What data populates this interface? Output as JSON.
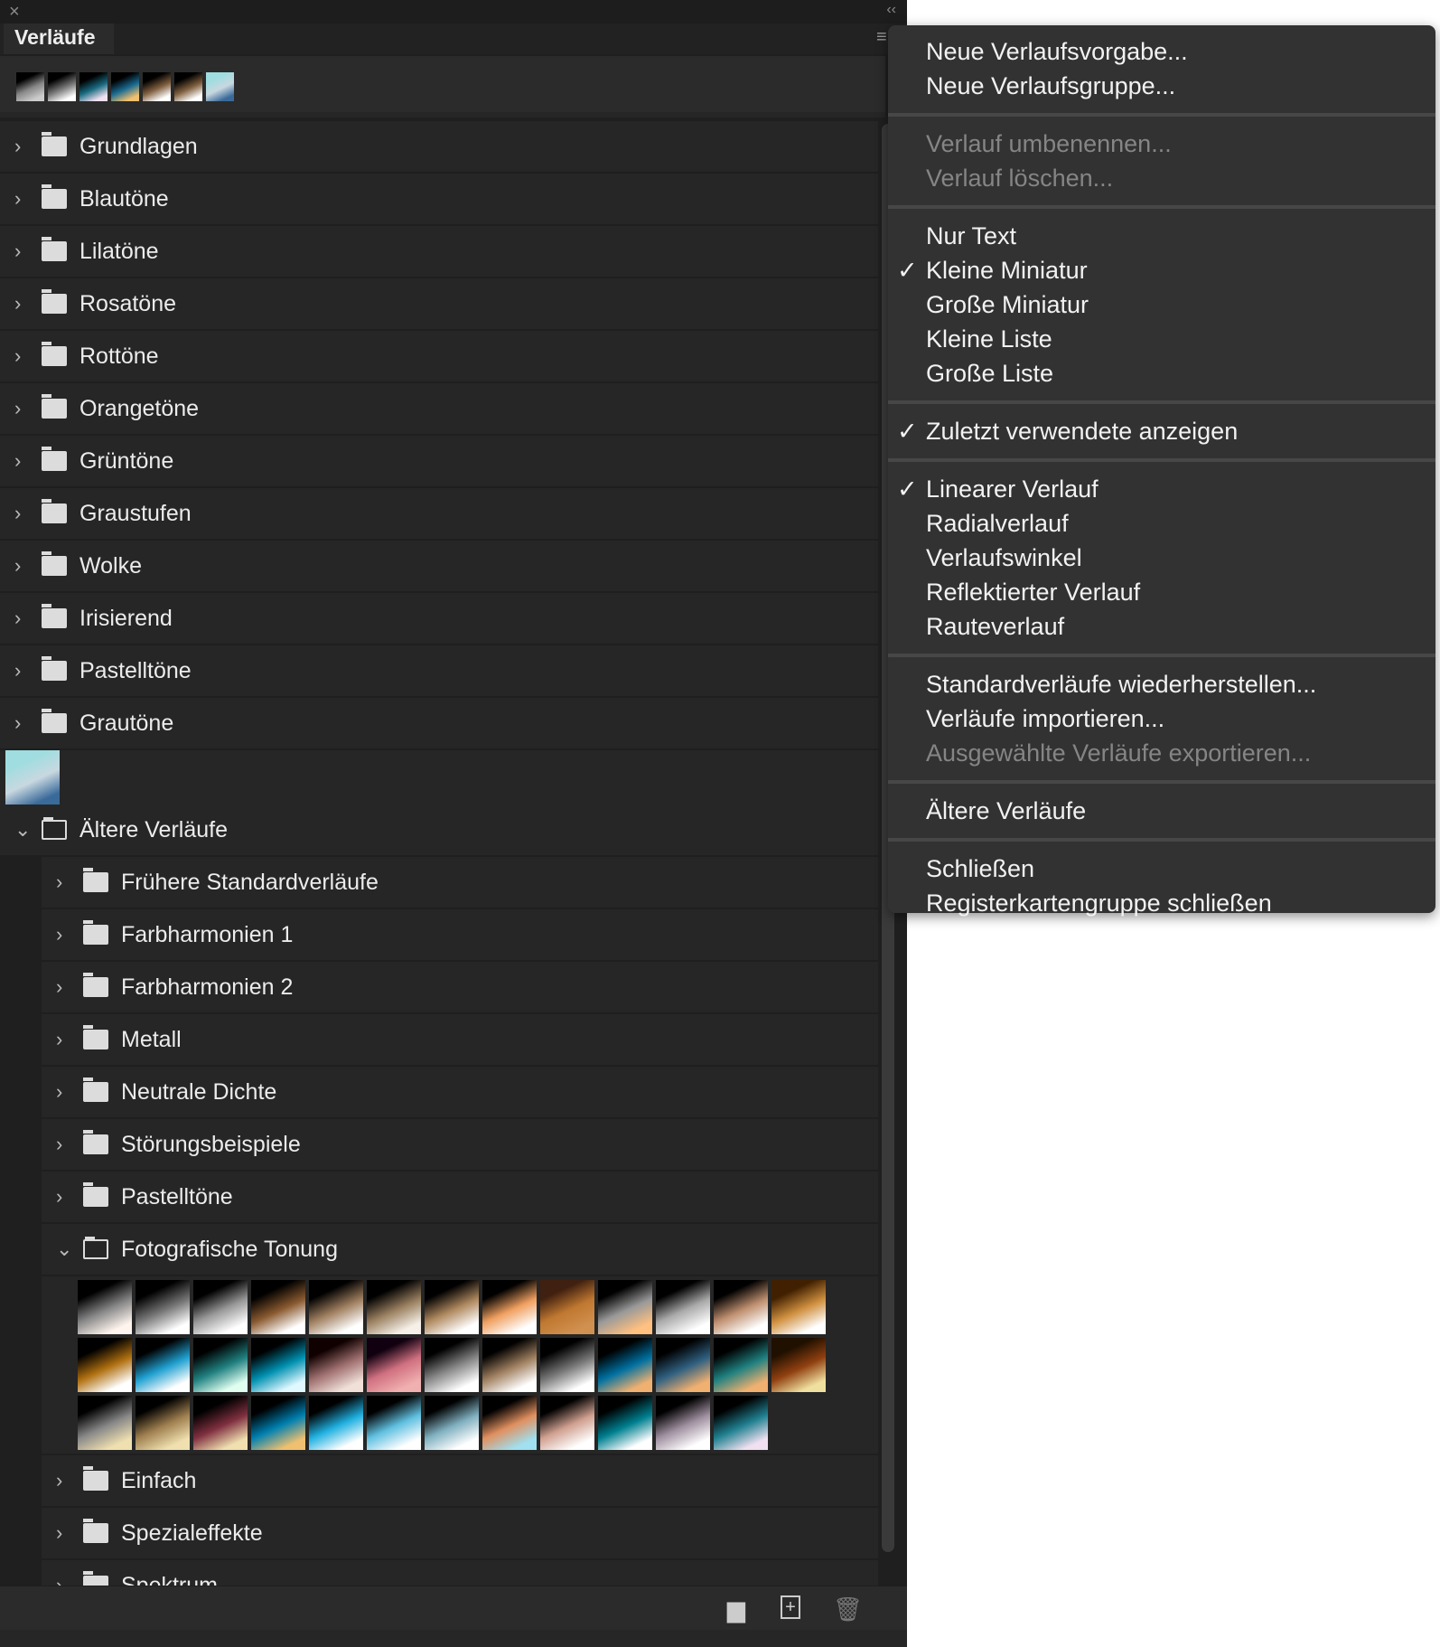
{
  "panel": {
    "title": "Verläufe",
    "close": "×",
    "collapse": "‹‹",
    "menu": "≡"
  },
  "recents": [
    [
      "#000",
      "#888",
      "#ccc"
    ],
    [
      "#000",
      "#777",
      "#fff"
    ],
    [
      "#000",
      "#1a6a80",
      "#f0e0f0"
    ],
    [
      "#000",
      "#1a6a90",
      "#f0c070"
    ],
    [
      "#000",
      "#806040",
      "#fff"
    ],
    [
      "#000",
      "#806040",
      "#fff"
    ],
    [
      "#9fdde0",
      "#c8d8e0",
      "#3a6a9a"
    ]
  ],
  "folders": [
    "Grundlagen",
    "Blautöne",
    "Lilatöne",
    "Rosatöne",
    "Rottöne",
    "Orangetöne",
    "Grüntöne",
    "Graustufen",
    "Wolke",
    "Irisierend",
    "Pastelltöne",
    "Grautöne"
  ],
  "single_swatch": [
    "#9fdde0",
    "#c8d8e0",
    "#3a6a9a"
  ],
  "legacy": {
    "label": "Ältere Verläufe",
    "children": [
      "Frühere Standardverläufe",
      "Farbharmonien 1",
      "Farbharmonien 2",
      "Metall",
      "Neutrale Dichte",
      "Störungsbeispiele",
      "Pastelltöne"
    ],
    "open_child": "Fotografische Tonung",
    "after": [
      "Einfach",
      "Spezialeffekte",
      "Spektrum"
    ]
  },
  "toning": [
    [
      "#000",
      "#888",
      "#fff5ee"
    ],
    [
      "#000",
      "#777",
      "#fff"
    ],
    [
      "#000",
      "#999",
      "#fff"
    ],
    [
      "#000",
      "#8a5a30",
      "#fff"
    ],
    [
      "#000",
      "#a08060",
      "#fff"
    ],
    [
      "#000",
      "#9a8060",
      "#f5f0e8"
    ],
    [
      "#000",
      "#b08a60",
      "#fff"
    ],
    [
      "#000",
      "#f0a060",
      "#fff"
    ],
    [
      "#402010",
      "#c07830",
      "#d09050"
    ],
    [
      "#000",
      "#999",
      "#ffc080"
    ],
    [
      "#000",
      "#aaa",
      "#fff"
    ],
    [
      "#000",
      "#c09070",
      "#fff"
    ],
    [
      "#402000",
      "#d09040",
      "#fff"
    ],
    [
      "#000",
      "#b07010",
      "#fff"
    ],
    [
      "#000",
      "#20a0d0",
      "#fff"
    ],
    [
      "#000",
      "#208080",
      "#e0fff0"
    ],
    [
      "#000",
      "#0090b0",
      "#e0f8ff"
    ],
    [
      "#100000",
      "#a07070",
      "#f0e0d8"
    ],
    [
      "#100010",
      "#d07080",
      "#f0b0b0"
    ],
    [
      "#000",
      "#888",
      "#fff"
    ],
    [
      "#000",
      "#a08060",
      "#fff"
    ],
    [
      "#000",
      "#777",
      "#fff"
    ],
    [
      "#000",
      "#0070a0",
      "#f0b070"
    ],
    [
      "#000",
      "#306080",
      "#f0b070"
    ],
    [
      "#000",
      "#208080",
      "#f0b070"
    ],
    [
      "#201000",
      "#904010",
      "#f0e0a0"
    ],
    [
      "#000",
      "#888",
      "#f0e0b0"
    ],
    [
      "#000",
      "#a08050",
      "#f0e0b0"
    ],
    [
      "#000",
      "#803040",
      "#f0e0b0"
    ],
    [
      "#000",
      "#0080b0",
      "#f0c070"
    ],
    [
      "#000",
      "#20b0e0",
      "#fff"
    ],
    [
      "#000",
      "#60c0e0",
      "#fff"
    ],
    [
      "#000",
      "#80b0c0",
      "#fff"
    ],
    [
      "#000",
      "#e09060",
      "#a0e0f0"
    ],
    [
      "#000",
      "#d0a090",
      "#fff"
    ],
    [
      "#000",
      "#008090",
      "#fff"
    ],
    [
      "#000",
      "#a090a0",
      "#fff"
    ],
    [
      "#000",
      "#208090",
      "#f0e0f0"
    ]
  ],
  "menu": [
    [
      {
        "label": "Neue Verlaufsvorgabe..."
      },
      {
        "label": "Neue Verlaufsgruppe..."
      }
    ],
    [
      {
        "label": "Verlauf umbenennen...",
        "disabled": true
      },
      {
        "label": "Verlauf löschen...",
        "disabled": true
      }
    ],
    [
      {
        "label": "Nur Text"
      },
      {
        "label": "Kleine Miniatur",
        "checked": true
      },
      {
        "label": "Große Miniatur"
      },
      {
        "label": "Kleine Liste"
      },
      {
        "label": "Große Liste"
      }
    ],
    [
      {
        "label": "Zuletzt verwendete anzeigen",
        "checked": true
      }
    ],
    [
      {
        "label": "Linearer Verlauf",
        "checked": true
      },
      {
        "label": "Radialverlauf"
      },
      {
        "label": "Verlaufswinkel"
      },
      {
        "label": "Reflektierter Verlauf"
      },
      {
        "label": "Rauteverlauf"
      }
    ],
    [
      {
        "label": "Standardverläufe wiederherstellen..."
      },
      {
        "label": "Verläufe importieren..."
      },
      {
        "label": "Ausgewählte Verläufe exportieren...",
        "disabled": true
      }
    ],
    [
      {
        "label": "Ältere Verläufe"
      }
    ],
    [
      {
        "label": "Schließen"
      },
      {
        "label": "Registerkartengruppe schließen"
      }
    ]
  ],
  "checkmark": "✓"
}
